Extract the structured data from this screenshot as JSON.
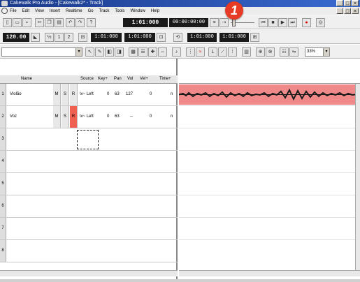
{
  "window": {
    "title": "Cakewalk Pro Audio - [Cakewalk2* - Track]"
  },
  "menu": {
    "items": [
      "File",
      "Edit",
      "View",
      "Insert",
      "Realtime",
      "Go",
      "Track",
      "Tools",
      "Window",
      "Help"
    ]
  },
  "transport": {
    "now_time": "1:01:000",
    "smpte": "00:00:00:00",
    "tempo": "120.00",
    "from_time": "1:01:000",
    "thru_time": "1:01:000",
    "loop_start": "1:01:000",
    "loop_end": "1:01:000"
  },
  "toolbar": {
    "zoom": "33%"
  },
  "badge": {
    "number": "1"
  },
  "tracks": {
    "columns": [
      "Name",
      "Source",
      "Key+",
      "Pan",
      "Vol",
      "Vel+",
      "Time+"
    ],
    "rows": [
      {
        "num": "1",
        "name": "Violão",
        "m": "M",
        "s": "S",
        "r": "R",
        "source": "\\v~ Left",
        "key": "0",
        "pan": "63",
        "vol": "127",
        "vel": "0",
        "time": "n"
      },
      {
        "num": "2",
        "name": "Voz",
        "m": "M",
        "s": "S",
        "r": "R",
        "source": "\\v~ Left",
        "key": "0",
        "pan": "63",
        "vol": "--",
        "vel": "0",
        "time": "n"
      },
      {
        "num": "3"
      },
      {
        "num": "4"
      },
      {
        "num": "5"
      },
      {
        "num": "6"
      },
      {
        "num": "7"
      },
      {
        "num": "8"
      }
    ]
  },
  "colors": {
    "clip": "#f08a8a",
    "record": "#f06050",
    "badge": "#e63b24"
  }
}
